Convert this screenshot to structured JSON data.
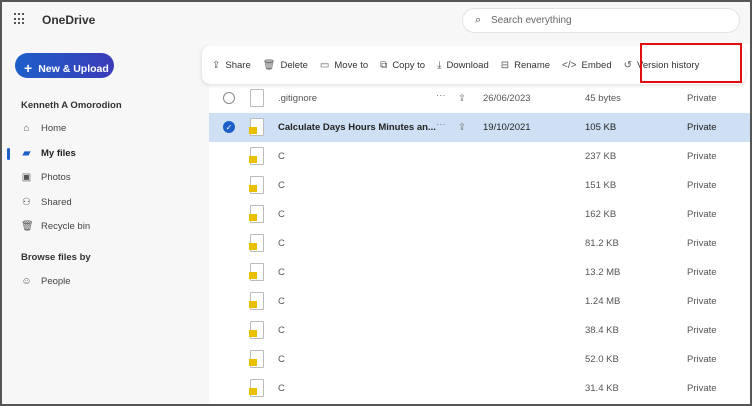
{
  "app": {
    "title": "OneDrive",
    "search_placeholder": "Search everything"
  },
  "sidebar": {
    "new_upload": "New & Upload",
    "user": "Kenneth A Omorodion",
    "items": [
      {
        "label": "Home",
        "icon": "home-icon"
      },
      {
        "label": "My files",
        "icon": "folder-icon",
        "active": true
      },
      {
        "label": "Photos",
        "icon": "photos-icon"
      },
      {
        "label": "Shared",
        "icon": "shared-icon"
      },
      {
        "label": "Recycle bin",
        "icon": "trash-icon"
      }
    ],
    "browse_header": "Browse files by",
    "browse_items": [
      {
        "label": "People",
        "icon": "person-icon"
      }
    ]
  },
  "toolbar": {
    "share": "Share",
    "delete": "Delete",
    "move_to": "Move to",
    "copy_to": "Copy to",
    "download": "Download",
    "rename": "Rename",
    "embed": "Embed",
    "version_history": "Version history"
  },
  "highlight_color": "#e01010",
  "files": [
    {
      "name": ".gitignore",
      "modified": "26/06/2023",
      "size": "45 bytes",
      "sharing": "Private",
      "selected": false
    },
    {
      "name": "Calculate Days Hours Minutes an...",
      "modified": "19/10/2021",
      "size": "105 KB",
      "sharing": "Private",
      "selected": true
    },
    {
      "name": "C",
      "size": "237 KB",
      "sharing": "Private"
    },
    {
      "name": "C",
      "size": "151 KB",
      "sharing": "Private"
    },
    {
      "name": "C",
      "size": "162 KB",
      "sharing": "Private"
    },
    {
      "name": "C",
      "size": "81.2 KB",
      "sharing": "Private"
    },
    {
      "name": "C",
      "size": "13.2 MB",
      "sharing": "Private"
    },
    {
      "name": "C",
      "size": "1.24 MB",
      "sharing": "Private"
    },
    {
      "name": "C",
      "size": "38.4 KB",
      "sharing": "Private"
    },
    {
      "name": "C",
      "size": "52.0 KB",
      "sharing": "Private"
    },
    {
      "name": "C",
      "size": "31.4 KB",
      "sharing": "Private"
    }
  ]
}
